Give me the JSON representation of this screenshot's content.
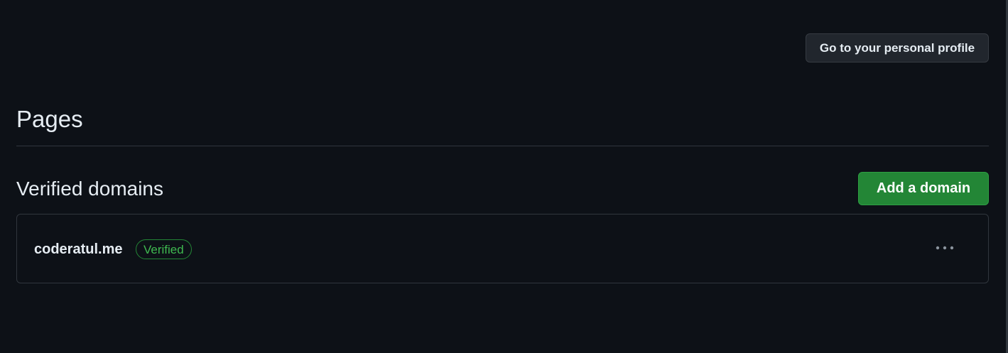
{
  "header": {
    "profile_button_label": "Go to your personal profile"
  },
  "page": {
    "title": "Pages"
  },
  "verified_domains": {
    "title": "Verified domains",
    "add_button_label": "Add a domain",
    "items": [
      {
        "domain": "coderatul.me",
        "status": "Verified",
        "menu_icon": "kebab-horizontal-icon"
      }
    ]
  },
  "colors": {
    "background": "#0d1117",
    "text": "#e6edf3",
    "border": "#30363d",
    "primary_button": "#238636",
    "success_text": "#3fb950"
  }
}
